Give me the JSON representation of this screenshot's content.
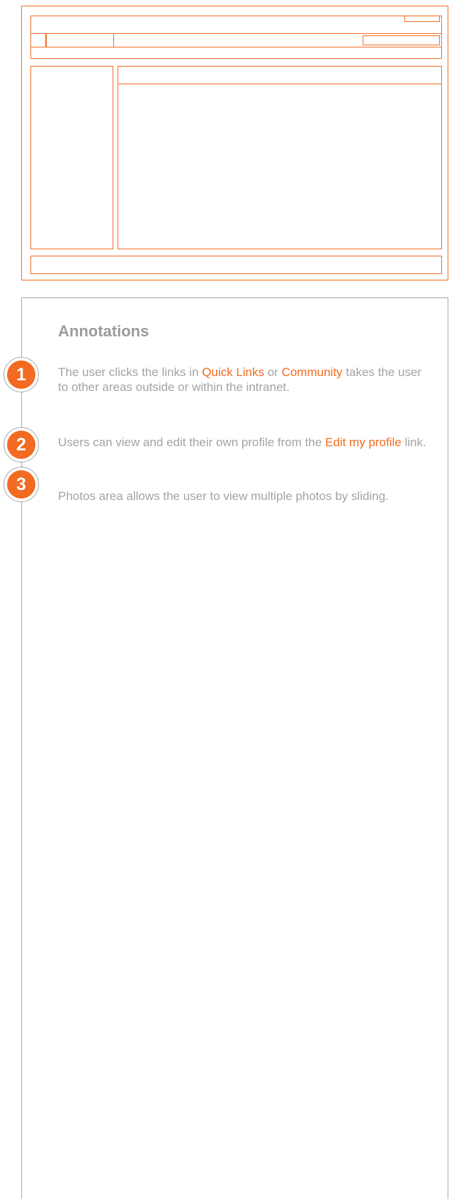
{
  "annotations": {
    "title": "Annotations",
    "notes": [
      {
        "number": "1",
        "segments": [
          {
            "text": "The user clicks the links in ",
            "highlight": false
          },
          {
            "text": "Quick Links",
            "highlight": true
          },
          {
            "text": " or ",
            "highlight": false
          },
          {
            "text": "Community",
            "highlight": true
          },
          {
            "text": " takes the user to other areas outside or within the intranet.",
            "highlight": false
          }
        ]
      },
      {
        "number": "2",
        "segments": [
          {
            "text": "Users can view and edit their own profile from the ",
            "highlight": false
          },
          {
            "text": "Edit my profile",
            "highlight": true
          },
          {
            "text": " link.",
            "highlight": false
          }
        ]
      },
      {
        "number": "3",
        "segments": [
          {
            "text": "Photos area allows the user to view multiple photos by sliding.",
            "highlight": false
          }
        ]
      }
    ]
  },
  "colors": {
    "accent": "#f26b21",
    "panel_border": "#a9a9a9",
    "text": "#a3a3a3"
  }
}
